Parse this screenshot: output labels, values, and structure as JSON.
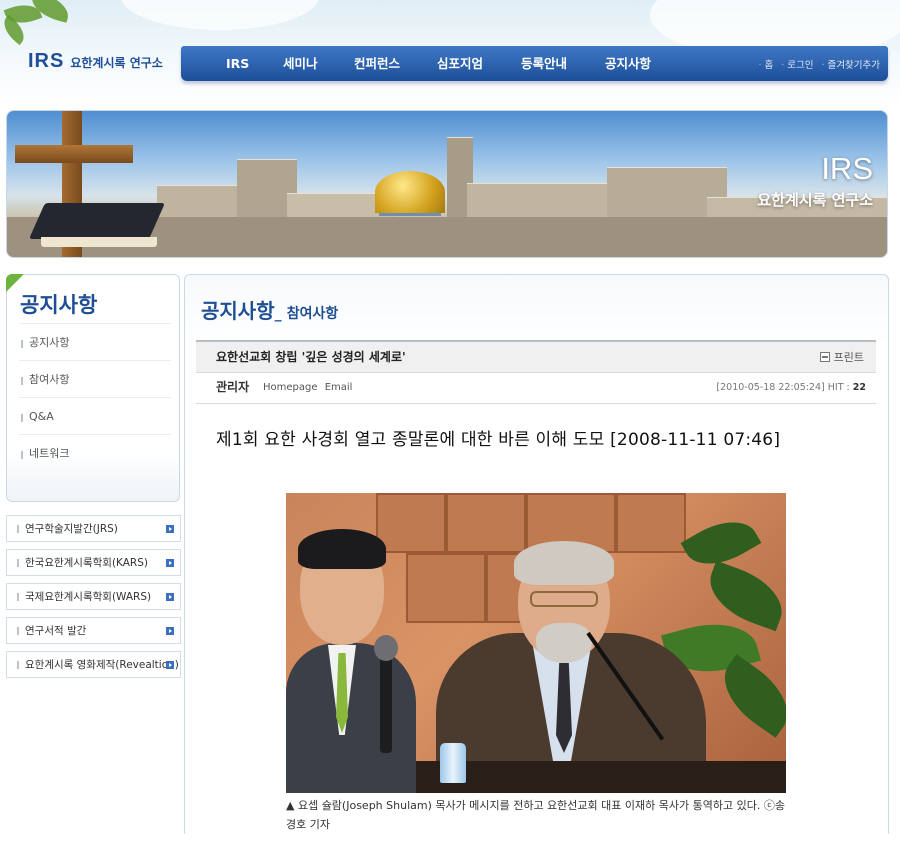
{
  "logo": {
    "mark": "IRS",
    "text": "요한계시록 연구소"
  },
  "gnb": {
    "menu": [
      "IRS",
      "세미나",
      "컨퍼런스",
      "심포지엄",
      "등록안내",
      "공지사항"
    ],
    "util": [
      "홈",
      "로그인",
      "즐겨찾기추가"
    ]
  },
  "banner": {
    "title": "IRS",
    "subtitle": "요한계시록 연구소"
  },
  "lnb": {
    "title": "공지사항",
    "items": [
      "공지사항",
      "참여사항",
      "Q&A",
      "네트워크"
    ]
  },
  "quick": [
    "연구학술지발간(JRS)",
    "한국요한계시록학회(KARS)",
    "국제요한계시록학회(WARS)",
    "연구서적 발간",
    "요한계시록 영화제작(Revealtion)"
  ],
  "page": {
    "title": "공지사항",
    "sep": "_",
    "subtitle": "참여사항"
  },
  "post": {
    "subject": "요한선교회 창립 '깊은 성경의 세계로'",
    "print_label": "프린트",
    "author": "관리자",
    "links": [
      "Homepage",
      "Email"
    ],
    "date": "[2010-05-18 22:05:24]",
    "hit_label": "HIT :",
    "hit_value": "22",
    "article_title": "제1회 요한 사경회 열고 종말론에 대한 바른 이해 도모 [2008-11-11 07:46]",
    "caption": "▲ 요셉 슐람(Joseph Shulam) 목사가 메시지를 전하고 요한선교회 대표 이재하 목사가 통역하고 있다. ⓒ송경호 기자"
  },
  "colors": {
    "brand_blue": "#1f4f93",
    "nav_blue": "#2a5eaa",
    "accent_green": "#6db33f"
  }
}
